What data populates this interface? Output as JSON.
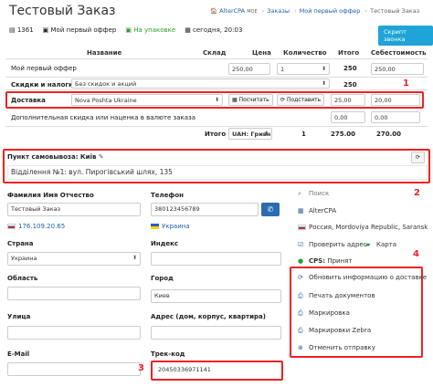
{
  "page": {
    "title": "Тестовый Заказ"
  },
  "breadcrumb": {
    "home": "AlterCPA",
    "home_suffix": "MOE",
    "orders": "Заказы",
    "offer": "Мой первый оффер",
    "current": "Тестовый Заказ"
  },
  "info": {
    "order_id": "1361",
    "offer": "Мой первый оффер",
    "status": "На упаковке",
    "date": "сегодня, 20:03",
    "callback_script": "Скрипт звонка"
  },
  "table": {
    "headers": {
      "name": "Название",
      "warehouse": "Склад",
      "price": "Цена",
      "qty": "Количество",
      "total": "Итого",
      "cost": "Себестоимость"
    },
    "product": {
      "name": "Мой первый оффер",
      "price": "250,00",
      "qty": "1",
      "total": "250",
      "cost": "250,00"
    },
    "discounts": {
      "label": "Скидки и налоги",
      "select": "Без скидок и акций",
      "total": "250"
    },
    "delivery": {
      "label": "Доставка",
      "service": "Nova Poshta Ukraine",
      "calc": "Посчитать",
      "apply": "Подставить",
      "price": "25,00",
      "cost": "20,00"
    },
    "extra": {
      "label": "Дополнительная скидка или наценка в валюте заказа",
      "v1": "0,00",
      "v2": "0,00"
    },
    "footer": {
      "label": "Итого",
      "currency": "UAH: Гривн",
      "qty": "1",
      "total": "275.00",
      "cost": "270.00"
    }
  },
  "pickup": {
    "label": "Пункт самовывоза: Київ",
    "value": "Відділення №1: вул. Пирогівський шлях, 135"
  },
  "form": {
    "fio_label": "Фамилия Имя Отчество",
    "fio": "Тестовый Заказ",
    "ip": "176.109.20.65",
    "phone_label": "Телефон",
    "phone": "380123456789",
    "phone_country": "Украина",
    "country_label": "Страна",
    "country": "Украина",
    "index_label": "Индекс",
    "index": "",
    "region_label": "Область",
    "region": "",
    "city_label": "Город",
    "city": "Киев",
    "street_label": "Улица",
    "street": "",
    "address_label": "Адрес (дом, корпус, квартира)",
    "address": "",
    "email_label": "E-Mail",
    "email": "",
    "track_label": "Трек-код",
    "track": "20450336971141"
  },
  "sidebar": {
    "search": "Поиск",
    "company": "AlterCPA",
    "geo": "Россия, Mordoviya Republic, Saransk",
    "check_address": "Проверить адрес",
    "map": "Карта",
    "cps_label": "CPS:",
    "cps_value": "Принят",
    "actions": [
      "Обновить информацию о доставке",
      "Печать документов",
      "Маркировка",
      "Маркировки Zebra",
      "Отменить отправку"
    ]
  },
  "annotations": [
    "1",
    "2",
    "3",
    "4"
  ],
  "colors": {
    "accent": "#1ea4d6",
    "annotation": "#e22222",
    "link": "#1f5ea8",
    "success": "#2e9b2e"
  }
}
